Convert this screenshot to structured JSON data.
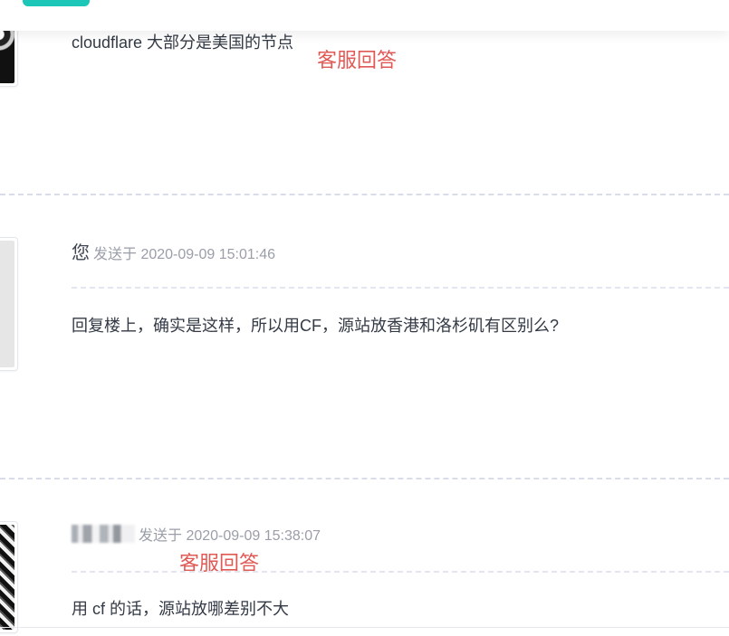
{
  "messages": [
    {
      "sender": "",
      "meta": "",
      "body": "cloudflare 大部分是美国的节点",
      "annotation": "客服回答"
    },
    {
      "sender": "您",
      "meta": "发送于 2020-09-09 15:01:46",
      "body": "回复楼上，确实是这样，所以用CF，源站放香港和洛杉矶有区别么?"
    },
    {
      "sender": "温**",
      "meta": "发送于 2020-09-09 15:38:07",
      "body": "用 cf 的话，源站放哪差别不大",
      "annotation": "客服回答"
    }
  ],
  "colors": {
    "accent": "#1cc7b7",
    "annotation": "#e05a55",
    "meta_text": "#9a9ea8",
    "body_text": "#333a45",
    "divider": "#d9dde9"
  }
}
